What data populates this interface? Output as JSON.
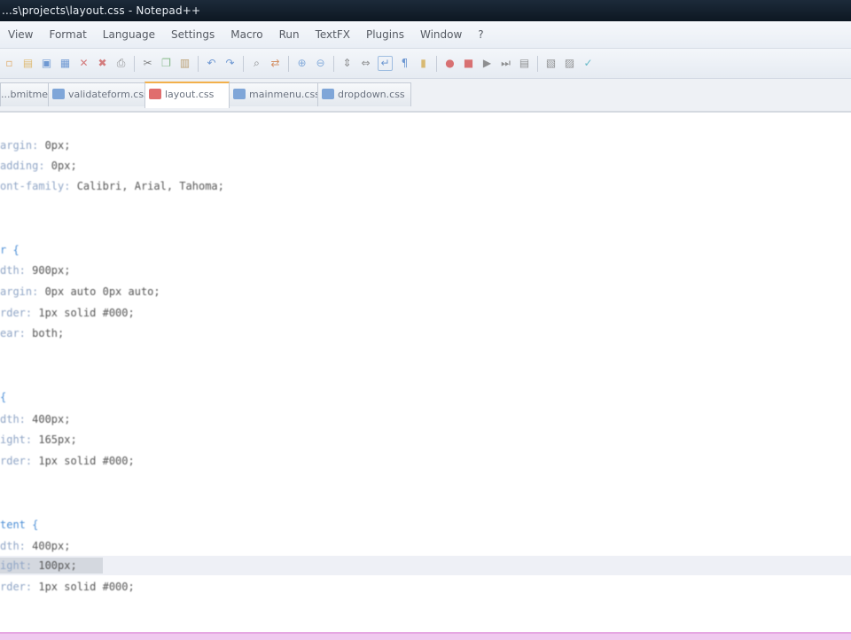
{
  "window": {
    "title": "...s\\projects\\layout.css - Notepad++"
  },
  "menu": {
    "items": [
      "View",
      "Format",
      "Language",
      "Settings",
      "Macro",
      "Run",
      "TextFX",
      "Plugins",
      "Window",
      "?"
    ]
  },
  "tabs": [
    {
      "label": "...bmitmenu.css",
      "active": false
    },
    {
      "label": "validateform.css",
      "active": false
    },
    {
      "label": "layout.css",
      "active": true
    },
    {
      "label": "mainmenu.css",
      "active": false
    },
    {
      "label": "dropdown.css",
      "active": false
    }
  ],
  "editor": {
    "lines": [
      {
        "prop": "argin:",
        "val": " 0px;"
      },
      {
        "prop": "adding:",
        "val": " 0px;"
      },
      {
        "prop": "ont-family:",
        "val": " Calibri, Arial, Tahoma;"
      },
      {
        "sel": "r {"
      },
      {
        "prop": "dth:",
        "val": " 900px;"
      },
      {
        "prop": "argin:",
        "val": " 0px auto 0px auto;"
      },
      {
        "prop": "rder:",
        "val": " 1px solid #000;"
      },
      {
        "prop": "ear:",
        "val": " both;"
      },
      {
        "sel": "{"
      },
      {
        "prop": "dth:",
        "val": " 400px;"
      },
      {
        "prop": "ight:",
        "val": " 165px;"
      },
      {
        "prop": "rder:",
        "val": " 1px solid #000;"
      },
      {
        "sel": "tent {"
      },
      {
        "prop": "dth:",
        "val": " 400px;"
      },
      {
        "prop": "ight:",
        "val": " 100px;"
      },
      {
        "prop": "rder:",
        "val": " 1px solid #000;"
      }
    ]
  },
  "icons": {
    "toolbar": [
      "new-file-icon",
      "open-file-icon",
      "save-icon",
      "save-all-icon",
      "close-icon",
      "close-all-icon",
      "print-icon",
      "cut-icon",
      "copy-icon",
      "paste-icon",
      "undo-icon",
      "redo-icon",
      "find-icon",
      "replace-icon",
      "zoom-in-icon",
      "zoom-out-icon",
      "sync-v-icon",
      "sync-h-icon",
      "word-wrap-icon",
      "show-all-icon",
      "indent-guide-icon",
      "record-macro-icon",
      "stop-record-icon",
      "play-macro-icon",
      "run-macro-icon",
      "save-macro-icon",
      "check-icon"
    ]
  }
}
